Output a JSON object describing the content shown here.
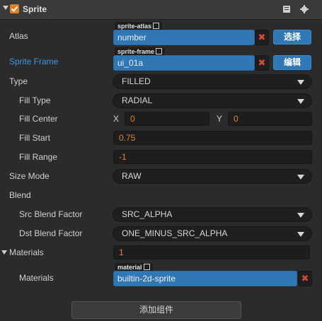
{
  "component": {
    "title": "Sprite",
    "enabled": true,
    "doc_icon": "book-icon",
    "settings_icon": "gear-icon"
  },
  "rows": {
    "atlas": {
      "label": "Atlas",
      "tag": "sprite-atlas",
      "value": "number",
      "action": "选择"
    },
    "sprite_frame": {
      "label": "Sprite Frame",
      "tag": "sprite-frame",
      "value": "ui_01a",
      "action": "编辑"
    },
    "type": {
      "label": "Type",
      "value": "FILLED"
    },
    "fill_type": {
      "label": "Fill Type",
      "value": "RADIAL"
    },
    "fill_center": {
      "label": "Fill Center",
      "x_label": "X",
      "x_value": "0",
      "y_label": "Y",
      "y_value": "0"
    },
    "fill_start": {
      "label": "Fill Start",
      "value": "0.75"
    },
    "fill_range": {
      "label": "Fill Range",
      "value": "-1"
    },
    "size_mode": {
      "label": "Size Mode",
      "value": "RAW"
    },
    "blend": {
      "label": "Blend"
    },
    "src_blend": {
      "label": "Src Blend Factor",
      "value": "SRC_ALPHA"
    },
    "dst_blend": {
      "label": "Dst Blend Factor",
      "value": "ONE_MINUS_SRC_ALPHA"
    },
    "materials_group": {
      "label": "Materials",
      "value": "1"
    },
    "materials": {
      "label": "Materials",
      "tag": "material",
      "value": "builtin-2d-sprite"
    }
  },
  "footer": {
    "add_component": "添加组件"
  },
  "colors": {
    "accent": "#e0802a",
    "asset_blue": "#2f77b5",
    "label_blue": "#3c96e6",
    "clear_red": "#d9473b"
  }
}
